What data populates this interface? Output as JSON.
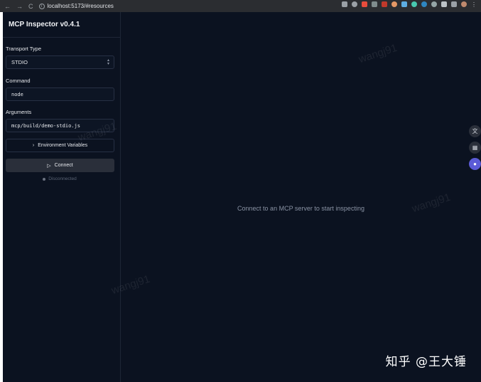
{
  "browser": {
    "url": "localhost:5173/#resources",
    "nav_icons": [
      "←",
      "→",
      "C"
    ],
    "extension_colors": [
      "#e74c3c",
      "#7f8c8d",
      "#c0392b",
      "#d35400",
      "#3498db",
      "#5dade2",
      "#48c9b0",
      "#2e86c1",
      "#95a5a6",
      "#bdc3c7",
      "#9b59b6"
    ]
  },
  "sidebar": {
    "title": "MCP Inspector v0.4.1",
    "transport_label": "Transport Type",
    "transport_value": "STDIO",
    "command_label": "Command",
    "command_value": "node",
    "arguments_label": "Arguments",
    "arguments_value": "mcp/build/demo-stdio.js",
    "env_button_label": "Environment Variables",
    "connect_label": "Connect",
    "status_text": "Disconnected"
  },
  "main": {
    "empty_message": "Connect to an MCP server to start inspecting"
  },
  "watermark_text": "wangj91",
  "attribution": "知乎 @王大锤",
  "float_icons": [
    "translate-icon",
    "grid-icon",
    "chat-icon"
  ]
}
